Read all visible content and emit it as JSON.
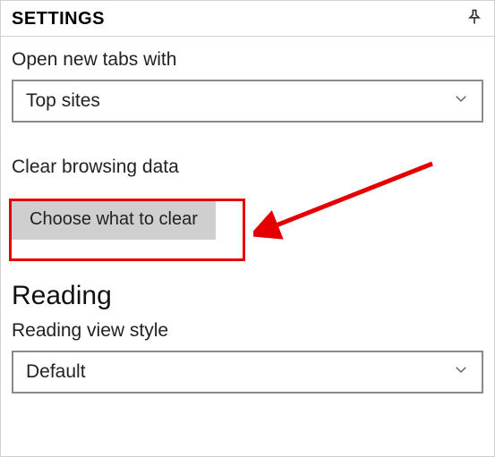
{
  "header": {
    "title": "SETTINGS"
  },
  "tabs": {
    "label": "Open new tabs with",
    "selected": "Top sites"
  },
  "clear": {
    "label": "Clear browsing data",
    "button": "Choose what to clear"
  },
  "reading": {
    "heading": "Reading",
    "style_label": "Reading view style",
    "style_selected": "Default"
  }
}
